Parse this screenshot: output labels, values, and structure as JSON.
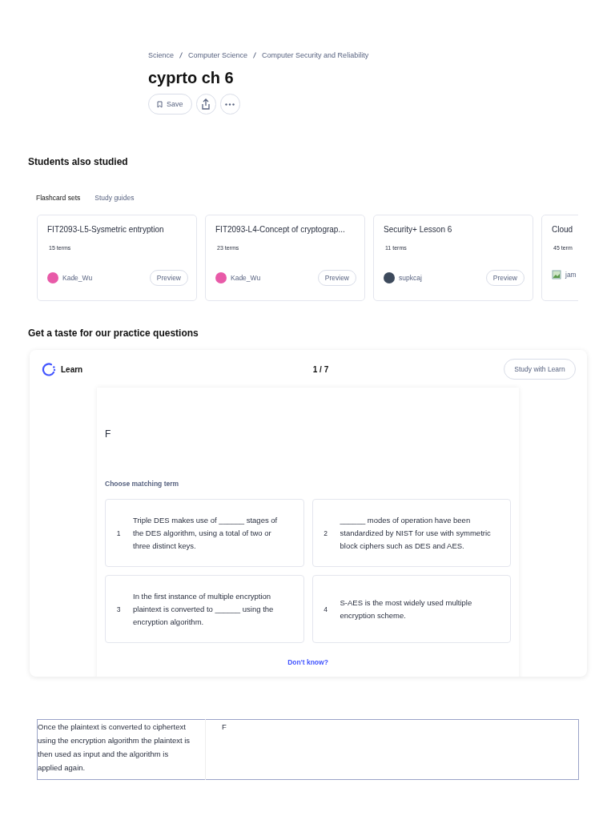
{
  "breadcrumbs": [
    "Science",
    "Computer Science",
    "Computer Security and Reliability"
  ],
  "title": "cyprto ch 6",
  "actions": {
    "save": "Save"
  },
  "students_also_studied": {
    "heading": "Students also studied",
    "tabs": [
      {
        "label": "Flashcard sets",
        "selected": true
      },
      {
        "label": "Study guides",
        "selected": false
      }
    ],
    "cards": [
      {
        "title": "FIT2093-L5-Sysmetric entryption",
        "terms": "15 terms",
        "user": "Kade_Wu",
        "avatar_broken": false,
        "button": "Preview"
      },
      {
        "title": "FIT2093-L4-Concept of cryptograp...",
        "terms": "23 terms",
        "user": "Kade_Wu",
        "avatar_broken": false,
        "button": "Preview"
      },
      {
        "title": "Security+ Lesson 6",
        "terms": "11 terms",
        "user": "supkcaj",
        "avatar_broken": false,
        "button": "Preview"
      },
      {
        "title": "Cloud",
        "terms": "45 term",
        "user": "jam",
        "avatar_broken": true
      }
    ]
  },
  "practice": {
    "heading": "Get a taste for our practice questions",
    "mode": "Learn",
    "progress": "1 / 7",
    "study_button": "Study with Learn",
    "prompt": "F",
    "instruction": "Choose matching term",
    "options": [
      {
        "number": "1",
        "text": "Triple DES makes use of ______ stages of the DES algorithm, using a total of two or three distinct keys."
      },
      {
        "number": "2",
        "text": "______ modes of operation have been standardized by NIST for use with symmetric block ciphers such as DES and AES."
      },
      {
        "number": "3",
        "text": "In the first instance of multiple encryption plaintext is converted to ______ using the encryption algorithm."
      },
      {
        "number": "4",
        "text": "S-AES is the most widely used multiple encryption scheme."
      }
    ],
    "dont_know": "Don't know?"
  },
  "table": {
    "rows": [
      {
        "term": "Once the plaintext is converted to ciphertext using the encryption algorithm the plaintext is then used as input and the algorithm is applied again.",
        "definition": "F"
      }
    ]
  }
}
